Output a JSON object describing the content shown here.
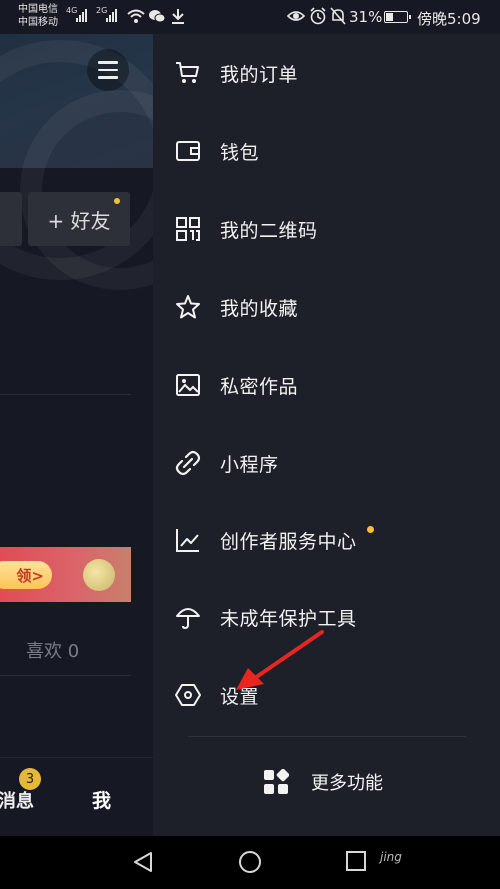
{
  "status_bar": {
    "carrier_1": "中国电信",
    "carrier_2": "中国移动",
    "sig_1": "4G",
    "sig_2": "2G",
    "battery": "31%",
    "time": "傍晚5:09"
  },
  "profile": {
    "add_friend": "+ 好友",
    "promo_button": "领>",
    "likes_tab": "喜欢 0",
    "messages_tab": "消息",
    "messages_badge": "3",
    "me_tab": "我"
  },
  "drawer": {
    "items": [
      {
        "label": "我的订单",
        "icon": "cart-icon"
      },
      {
        "label": "钱包",
        "icon": "wallet-icon"
      },
      {
        "label": "我的二维码",
        "icon": "qr-code-icon"
      },
      {
        "label": "我的收藏",
        "icon": "star-icon"
      },
      {
        "label": "私密作品",
        "icon": "image-icon"
      },
      {
        "label": "小程序",
        "icon": "link-icon"
      },
      {
        "label": "创作者服务中心",
        "icon": "chart-icon",
        "new": true
      },
      {
        "label": "未成年保护工具",
        "icon": "umbrella-icon"
      },
      {
        "label": "设置",
        "icon": "hexagon-settings-icon"
      }
    ],
    "more_features": "更多功能"
  },
  "watermark": "jing",
  "colors": {
    "background": "#161823",
    "drawer": "#1e2029",
    "accent_dot": "#f5c22d",
    "annotation": "#e8261f"
  }
}
